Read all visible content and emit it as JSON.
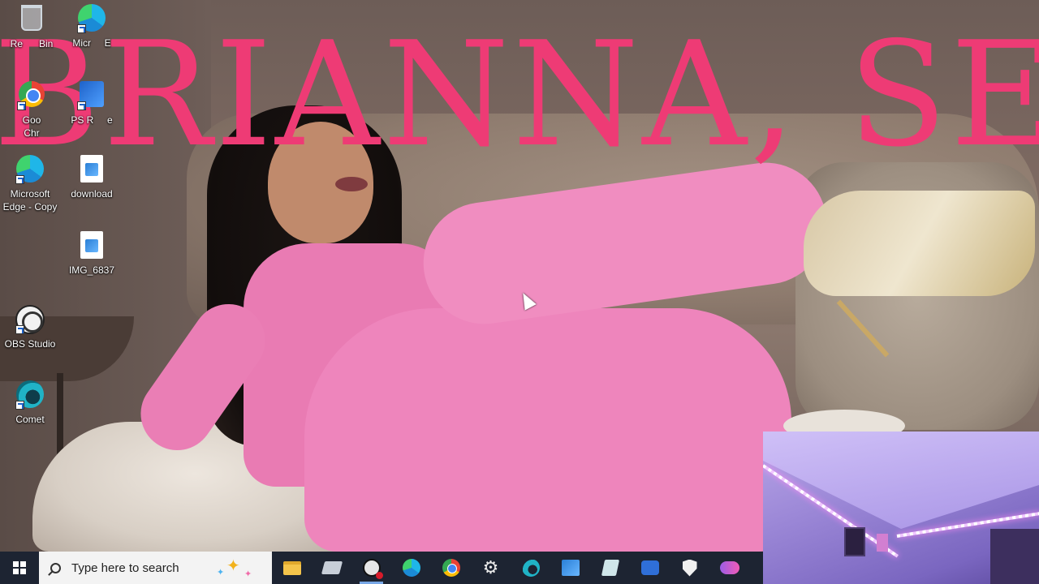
{
  "wallpaper": {
    "overlay_text": "BRIANNA, SE",
    "overlay_color": "#ee3b75"
  },
  "desktop_icons": [
    {
      "label": "Recycle Bin",
      "visible_label": "Re      Bin",
      "icon": "recycle-bin-icon"
    },
    {
      "label": "Microsoft Edge",
      "visible_label": "Micr     E",
      "icon": "edge-icon"
    },
    {
      "label": "Google Chrome",
      "visible_label": "Goo\nChr",
      "icon": "chrome-icon"
    },
    {
      "label": "PS Remote Play",
      "visible_label": "PS R     e",
      "icon": "ps-remote-play-icon"
    },
    {
      "label": "Microsoft Edge - Copy",
      "visible_label": "Microsoft\nEdge - Copy",
      "icon": "edge-icon"
    },
    {
      "label": "download",
      "visible_label": "download",
      "icon": "image-file-icon"
    },
    {
      "label": "IMG_6837",
      "visible_label": "IMG_6837",
      "icon": "image-file-icon"
    },
    {
      "label": "OBS Studio",
      "visible_label": "OBS Studio",
      "icon": "obs-icon"
    },
    {
      "label": "Comet",
      "visible_label": "Comet",
      "icon": "comet-icon"
    }
  ],
  "taskbar": {
    "search_placeholder": "Type here to search",
    "accent_color": "#78a7e6",
    "background_color": "#1d2432",
    "pinned": [
      {
        "name": "file-explorer",
        "icon": "folder-icon"
      },
      {
        "name": "drive",
        "icon": "drive-icon"
      },
      {
        "name": "obs-studio",
        "icon": "obs-icon",
        "active": true
      },
      {
        "name": "microsoft-edge",
        "icon": "edge-icon"
      },
      {
        "name": "google-chrome",
        "icon": "chrome-icon"
      },
      {
        "name": "settings",
        "icon": "gear-icon"
      },
      {
        "name": "comet",
        "icon": "comet-icon"
      },
      {
        "name": "photos",
        "icon": "photos-icon"
      },
      {
        "name": "notes",
        "icon": "notes-icon"
      },
      {
        "name": "game-bar",
        "icon": "game-bar-icon"
      },
      {
        "name": "security",
        "icon": "shield-icon"
      },
      {
        "name": "gaming",
        "icon": "gamepad-icon"
      }
    ]
  }
}
